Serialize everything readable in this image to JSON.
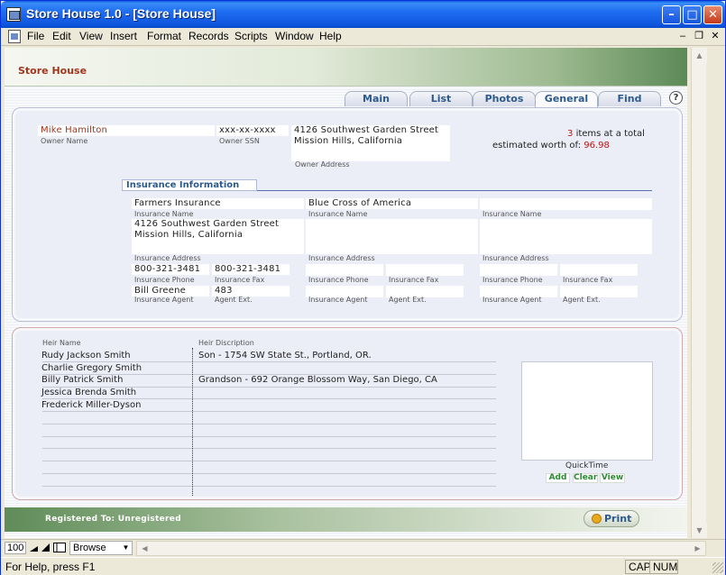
{
  "window": {
    "title": "Store House 1.0 - [Store House]",
    "minimize": "–",
    "maximize": "□",
    "close": "✕"
  },
  "menu": {
    "items": [
      "File",
      "Edit",
      "View",
      "Insert",
      "Format",
      "Records",
      "Scripts",
      "Window",
      "Help"
    ],
    "mdi_minimize": "–",
    "mdi_restore": "❐",
    "mdi_close": "✕"
  },
  "header": {
    "app_name": "Store House"
  },
  "tabs": [
    {
      "label": "Main",
      "active": false
    },
    {
      "label": "List",
      "active": false
    },
    {
      "label": "Photos",
      "active": false
    },
    {
      "label": "General",
      "active": true
    },
    {
      "label": "Find",
      "active": false
    }
  ],
  "help_button": "?",
  "owner": {
    "name": "Mike Hamilton",
    "name_label": "Owner Name",
    "ssn": "xxx-xx-xxxx",
    "ssn_label": "Owner SSN",
    "address_line1": "4126 Southwest Garden Street",
    "address_line2": "Mission Hills, California",
    "address_label": "Owner Address"
  },
  "summary": {
    "count": "3",
    "text1": "items at a total",
    "text2": "estimated worth of:",
    "worth": "96.98"
  },
  "insurance": {
    "section_title": "Insurance Information",
    "name_label": "Insurance Name",
    "address_label": "Insurance Address",
    "phone_label": "Insurance Phone",
    "fax_label": "Insurance Fax",
    "agent_label": "Insurance Agent",
    "ext_label": "Agent Ext.",
    "providers": [
      {
        "name": "Farmers Insurance",
        "address_line1": "4126 Southwest Garden Street",
        "address_line2": "Mission Hills, California",
        "phone": "800-321-3481",
        "fax": "800-321-3481",
        "agent": "Bill Greene",
        "ext": "483"
      },
      {
        "name": "Blue Cross of America",
        "address_line1": "",
        "address_line2": "",
        "phone": "",
        "fax": "",
        "agent": "",
        "ext": ""
      },
      {
        "name": "",
        "address_line1": "",
        "address_line2": "",
        "phone": "",
        "fax": "",
        "agent": "",
        "ext": ""
      }
    ]
  },
  "heirs": {
    "name_header": "Heir Name",
    "desc_header": "Heir Discription",
    "rows": [
      {
        "name": "Rudy Jackson Smith",
        "description": "Son - 1754 SW State St., Portland, OR."
      },
      {
        "name": "Charlie Gregory Smith",
        "description": ""
      },
      {
        "name": "Billy Patrick Smith",
        "description": "Grandson - 692 Orange Blossom Way, San Diego, CA"
      },
      {
        "name": "Jessica Brenda Smith",
        "description": ""
      },
      {
        "name": "Frederick Miller-Dyson",
        "description": ""
      }
    ]
  },
  "photo": {
    "label": "QuickTime",
    "add": "Add",
    "clear": "Clear",
    "view": "View"
  },
  "footer": {
    "registered": "Registered To: Unregistered",
    "print": "Print"
  },
  "bottombar": {
    "zoom": "100",
    "mode": "Browse"
  },
  "statusbar": {
    "text": "For Help, press F1",
    "cap": "CAP",
    "num": "NUM"
  }
}
